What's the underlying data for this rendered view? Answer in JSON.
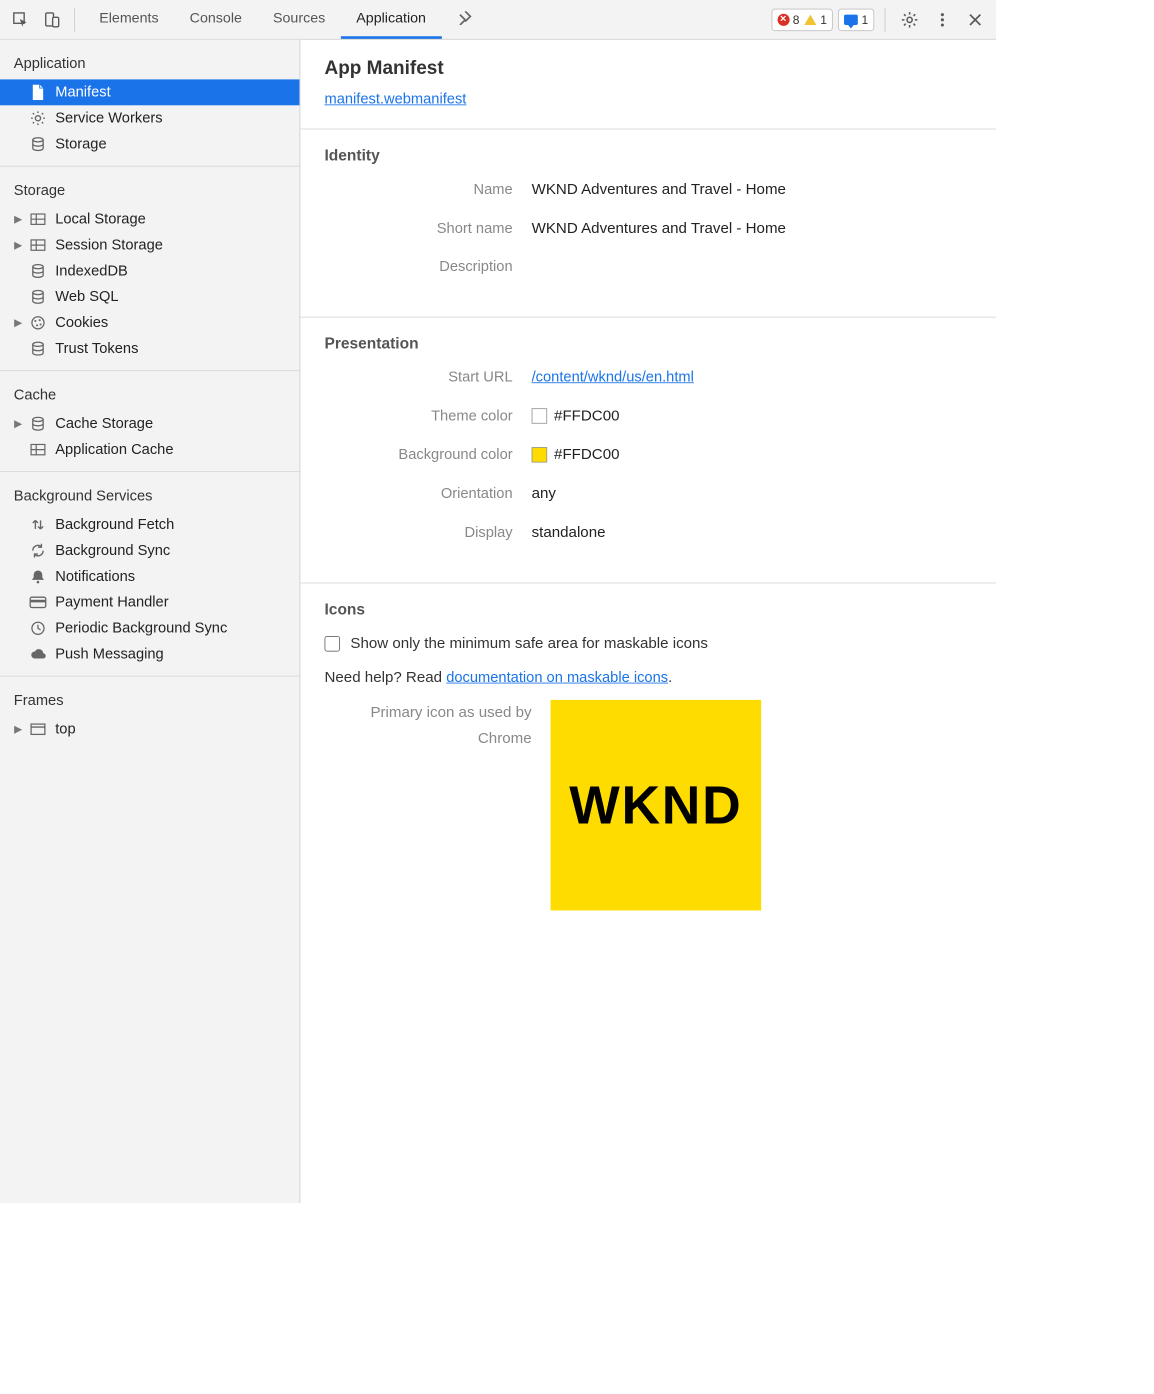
{
  "topbar": {
    "tabs": [
      "Elements",
      "Console",
      "Sources",
      "Application"
    ],
    "active_tab_index": 3,
    "errors": "8",
    "warnings": "1",
    "messages": "1"
  },
  "sidebar": {
    "sections": {
      "application": {
        "title": "Application",
        "items": [
          {
            "label": "Manifest",
            "icon": "file-icon",
            "selected": true,
            "chev": false
          },
          {
            "label": "Service Workers",
            "icon": "gear-icon",
            "selected": false,
            "chev": false
          },
          {
            "label": "Storage",
            "icon": "db-icon",
            "selected": false,
            "chev": false
          }
        ]
      },
      "storage": {
        "title": "Storage",
        "items": [
          {
            "label": "Local Storage",
            "icon": "grid-icon",
            "chev": true
          },
          {
            "label": "Session Storage",
            "icon": "grid-icon",
            "chev": true
          },
          {
            "label": "IndexedDB",
            "icon": "db-icon",
            "chev": false
          },
          {
            "label": "Web SQL",
            "icon": "db-icon",
            "chev": false
          },
          {
            "label": "Cookies",
            "icon": "cookie-icon",
            "chev": true
          },
          {
            "label": "Trust Tokens",
            "icon": "db-icon",
            "chev": false
          }
        ]
      },
      "cache": {
        "title": "Cache",
        "items": [
          {
            "label": "Cache Storage",
            "icon": "db-icon",
            "chev": true
          },
          {
            "label": "Application Cache",
            "icon": "grid-icon",
            "chev": false
          }
        ]
      },
      "bgservices": {
        "title": "Background Services",
        "items": [
          {
            "label": "Background Fetch",
            "icon": "updown-icon"
          },
          {
            "label": "Background Sync",
            "icon": "sync-icon"
          },
          {
            "label": "Notifications",
            "icon": "bell-icon"
          },
          {
            "label": "Payment Handler",
            "icon": "card-icon"
          },
          {
            "label": "Periodic Background Sync",
            "icon": "clock-icon"
          },
          {
            "label": "Push Messaging",
            "icon": "cloud-icon"
          }
        ]
      },
      "frames": {
        "title": "Frames",
        "items": [
          {
            "label": "top",
            "icon": "window-icon",
            "chev": true
          }
        ]
      }
    }
  },
  "main": {
    "title": "App Manifest",
    "manifest_link": "manifest.webmanifest",
    "identity": {
      "title": "Identity",
      "name_label": "Name",
      "name_value": "WKND Adventures and Travel - Home",
      "shortname_label": "Short name",
      "shortname_value": "WKND Adventures and Travel - Home",
      "description_label": "Description",
      "description_value": ""
    },
    "presentation": {
      "title": "Presentation",
      "starturl_label": "Start URL",
      "starturl_value": "/content/wknd/us/en.html",
      "themecolor_label": "Theme color",
      "themecolor_value": "#FFDC00",
      "bgcolor_label": "Background color",
      "bgcolor_value": "#FFDC00",
      "orientation_label": "Orientation",
      "orientation_value": "any",
      "display_label": "Display",
      "display_value": "standalone"
    },
    "icons": {
      "title": "Icons",
      "checkbox_label": "Show only the minimum safe area for maskable icons",
      "help_prefix": "Need help? Read ",
      "help_link": "documentation on maskable icons",
      "help_suffix": ".",
      "primary_label_line1": "Primary icon as used by",
      "primary_label_line2": "Chrome",
      "icon_text": "WKND"
    }
  }
}
